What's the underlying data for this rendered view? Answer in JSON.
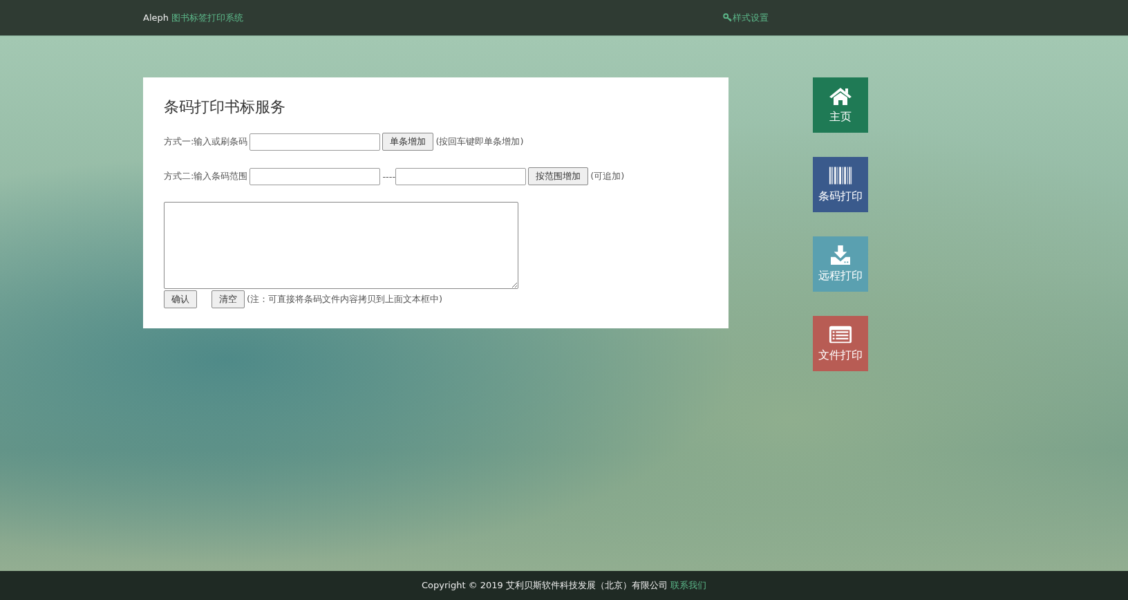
{
  "navbar": {
    "brand": "Aleph",
    "title": "图书标签打印系统",
    "settings_link": "样式设置"
  },
  "panel": {
    "title": "条码打印书标服务",
    "single": {
      "label": "方式一:输入或刷条码",
      "button": "单条增加",
      "hint": "(按回车键即单条增加)"
    },
    "range": {
      "label": "方式二:输入条码范围",
      "separator": "----",
      "button": "按范围增加",
      "hint": "(可追加)"
    },
    "buttons": [
      "确认",
      "清空"
    ],
    "note": "(注：可直接将条码文件内容拷贝到上面文本框中)"
  },
  "tiles": [
    {
      "kind": "home",
      "label": "主页",
      "color": "#1f7a55"
    },
    {
      "kind": "barcode",
      "label": "条码打印",
      "color": "#3a5a8c"
    },
    {
      "kind": "download",
      "label": "远程打印",
      "color": "#5aa0b0"
    },
    {
      "kind": "list",
      "label": "文件打印",
      "color": "#b85c54"
    }
  ],
  "footer": {
    "copyright": "Copyright © 2019 艾利贝斯软件科技发展（北京）有限公司",
    "contact_link": "联系我们"
  }
}
